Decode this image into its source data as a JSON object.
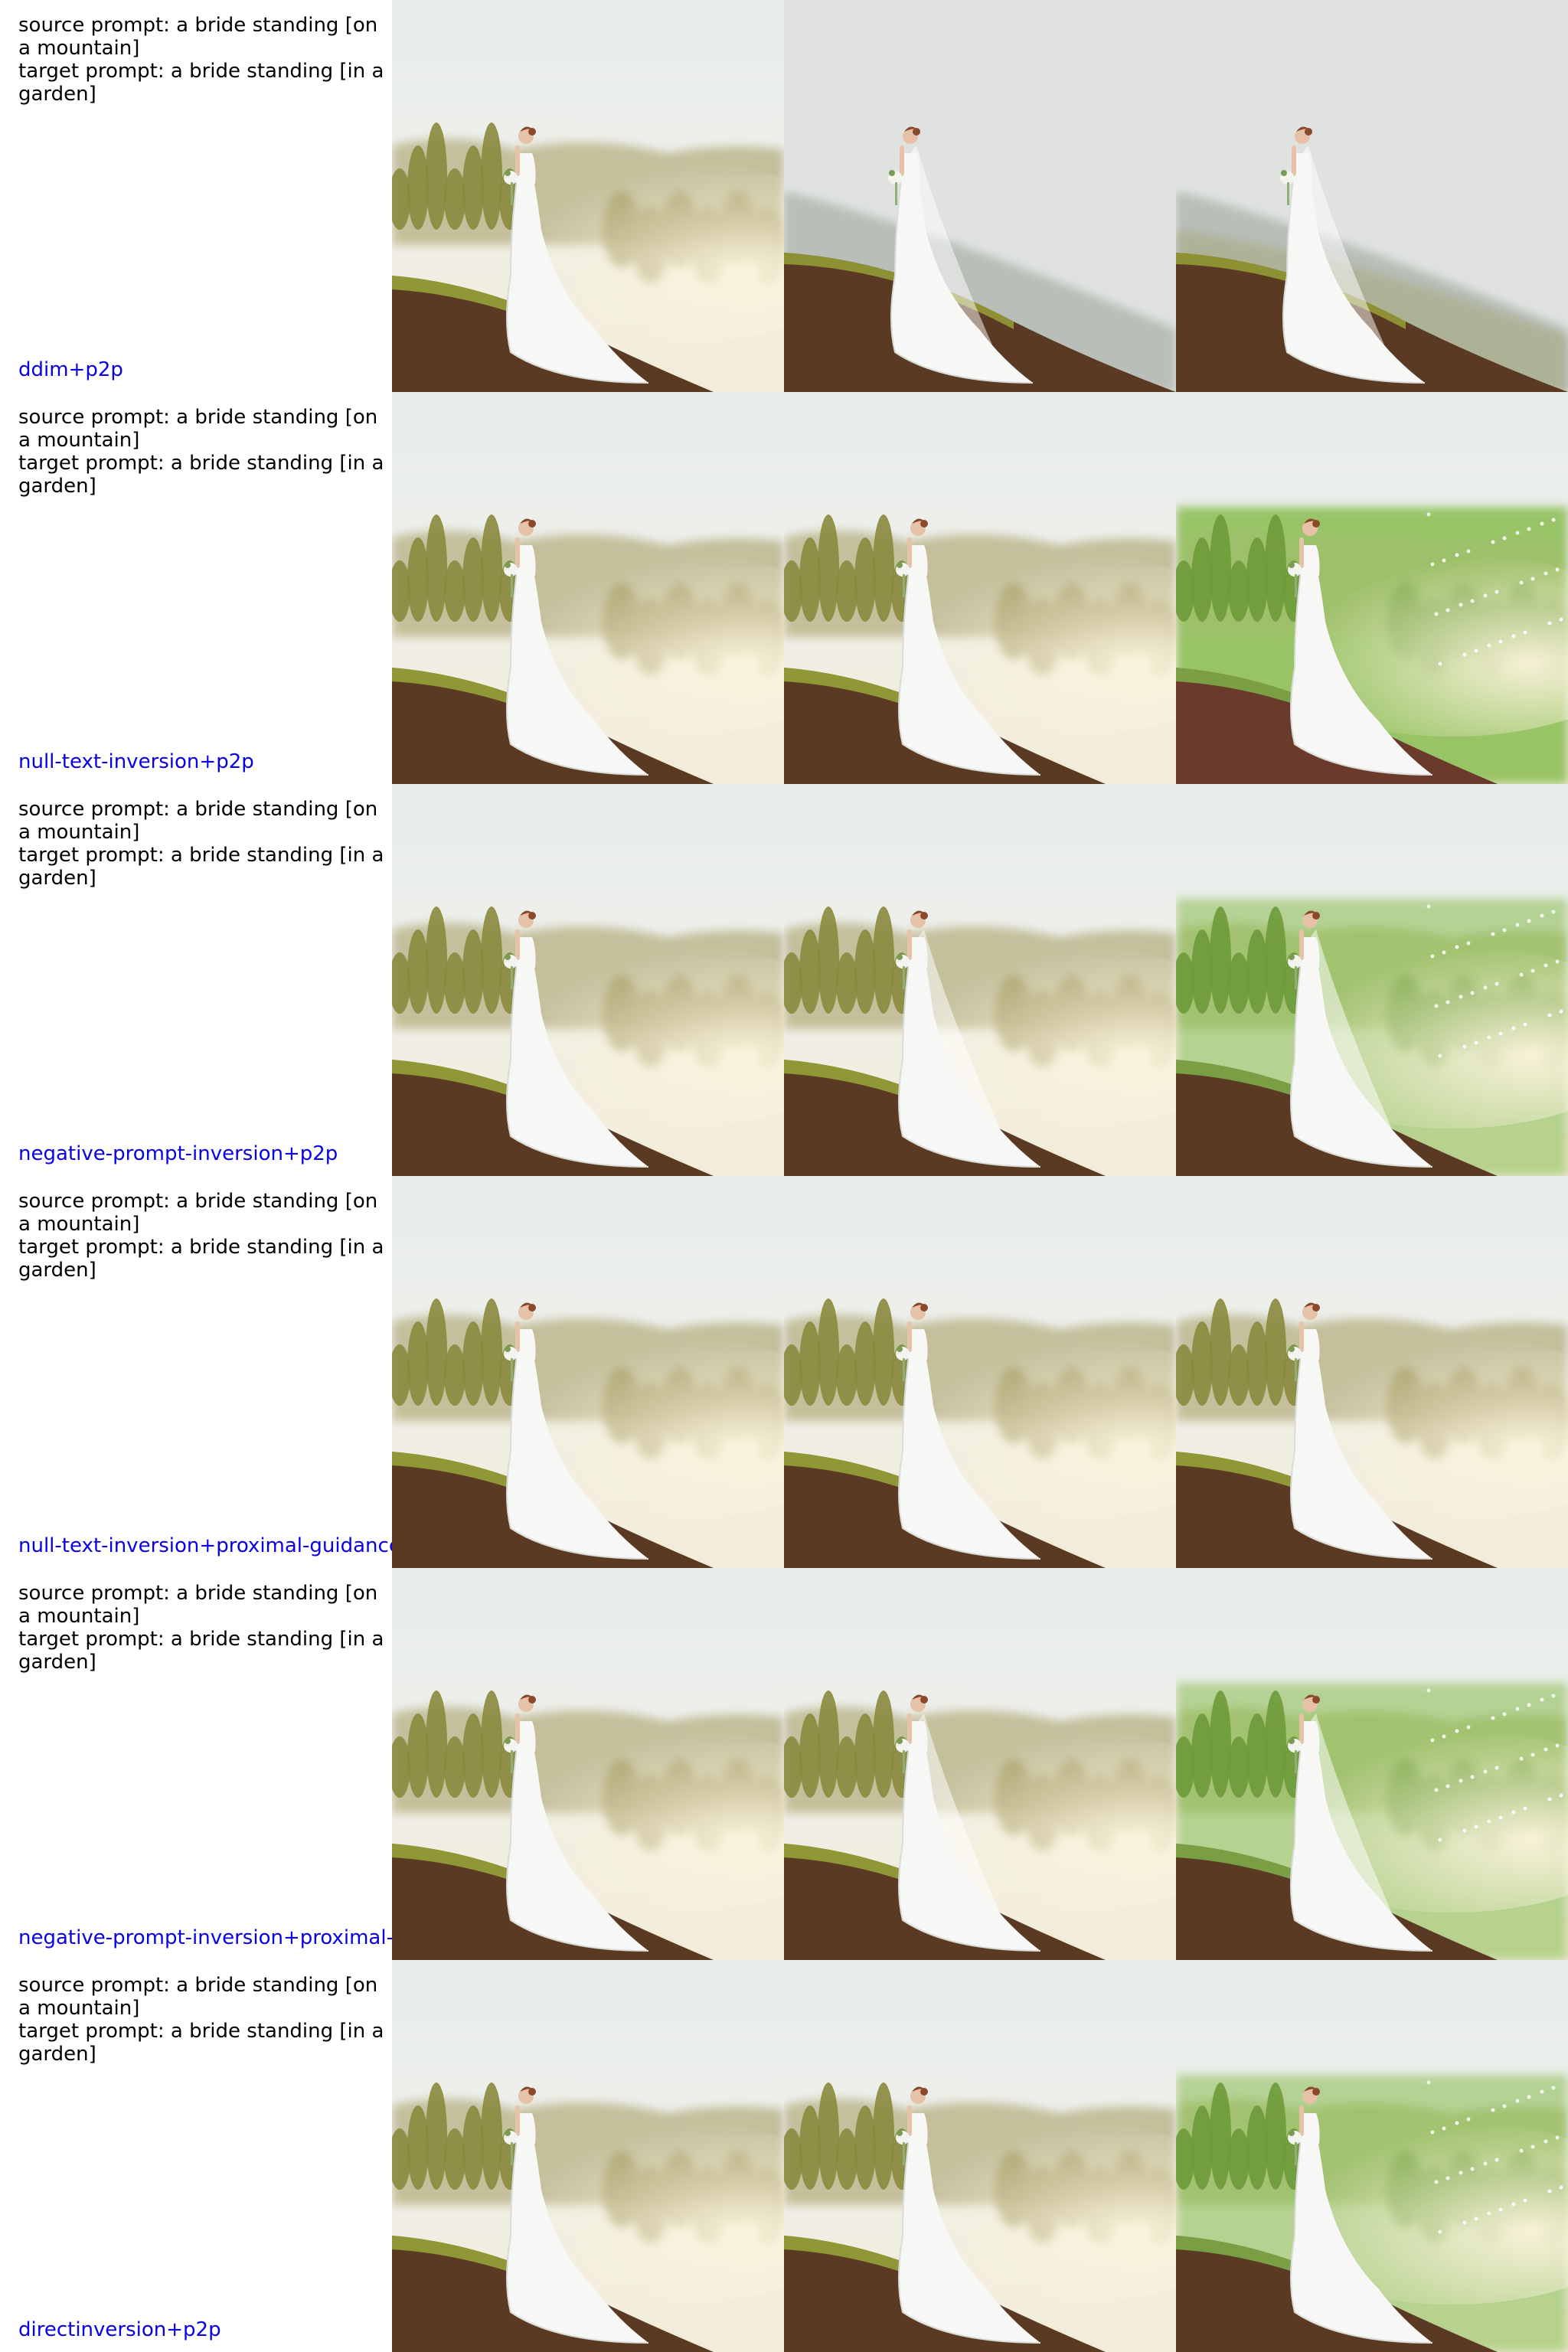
{
  "rows": [
    {
      "source_prompt": "source prompt: a bride standing [on a mountain]",
      "target_prompt": "target prompt: a bride standing [in a garden]",
      "method": "ddim+p2p",
      "cells": [
        {
          "scene": "foggy-mountain",
          "veil": false,
          "garden": false
        },
        {
          "scene": "grey-hill",
          "veil": true,
          "garden": false
        },
        {
          "scene": "grey-hill-green",
          "veil": true,
          "garden": false
        }
      ]
    },
    {
      "source_prompt": "source prompt: a bride standing [on a mountain]",
      "target_prompt": "target prompt: a bride standing [in a garden]",
      "method": "null-text-inversion+p2p",
      "cells": [
        {
          "scene": "foggy-mountain",
          "veil": false,
          "garden": false
        },
        {
          "scene": "foggy-mountain",
          "veil": false,
          "garden": false
        },
        {
          "scene": "garden",
          "veil": false,
          "garden": true
        }
      ]
    },
    {
      "source_prompt": "source prompt: a bride standing [on a mountain]",
      "target_prompt": "target prompt: a bride standing [in a garden]",
      "method": "negative-prompt-inversion+p2p",
      "cells": [
        {
          "scene": "foggy-mountain",
          "veil": false,
          "garden": false
        },
        {
          "scene": "foggy-mountain",
          "veil": true,
          "garden": false
        },
        {
          "scene": "garden-fog",
          "veil": true,
          "garden": true
        }
      ]
    },
    {
      "source_prompt": "source prompt: a bride standing [on a mountain]",
      "target_prompt": "target prompt: a bride standing [in a garden]",
      "method": "null-text-inversion+proximal-guidance",
      "cells": [
        {
          "scene": "foggy-mountain",
          "veil": false,
          "garden": false
        },
        {
          "scene": "foggy-mountain",
          "veil": false,
          "garden": false
        },
        {
          "scene": "foggy-mountain",
          "veil": false,
          "garden": false
        }
      ]
    },
    {
      "source_prompt": "source prompt: a bride standing [on a mountain]",
      "target_prompt": "target prompt: a bride standing [in a garden]",
      "method": "negative-prompt-inversion+proximal-g",
      "cells": [
        {
          "scene": "foggy-mountain",
          "veil": false,
          "garden": false
        },
        {
          "scene": "foggy-mountain",
          "veil": true,
          "garden": false
        },
        {
          "scene": "garden-fog",
          "veil": true,
          "garden": true
        }
      ]
    },
    {
      "source_prompt": "source prompt: a bride standing [on a mountain]",
      "target_prompt": "target prompt: a bride standing [in a garden]",
      "method": "directinversion+p2p",
      "cells": [
        {
          "scene": "foggy-mountain",
          "veil": false,
          "garden": false
        },
        {
          "scene": "foggy-mountain",
          "veil": false,
          "garden": false
        },
        {
          "scene": "garden-fog",
          "veil": false,
          "garden": true
        }
      ]
    }
  ],
  "colors": {
    "method_label": "#0a00e6",
    "prompt_text": "#000000",
    "sky": "#e8ecea",
    "fog": "#f1ead6",
    "trees": "#8a8a3e",
    "ground": "#5a3a22",
    "grass": "#9aa83a",
    "garden_green": "#8fc05a",
    "dress": "#f7f7f5"
  }
}
